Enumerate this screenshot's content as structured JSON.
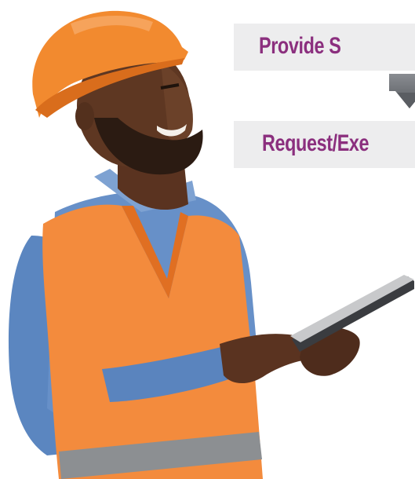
{
  "flow": {
    "step1_label": "Provide S",
    "step2_label": "Request/Exe"
  },
  "colors": {
    "label_text": "#8b2f7e",
    "band_bg": "#ededee",
    "arrow": "#666a70",
    "helmet": "#f0852e",
    "vest": "#f28a3c",
    "shirt": "#5d87bf"
  },
  "photo": {
    "subject": "construction-worker-holding-tablet"
  }
}
